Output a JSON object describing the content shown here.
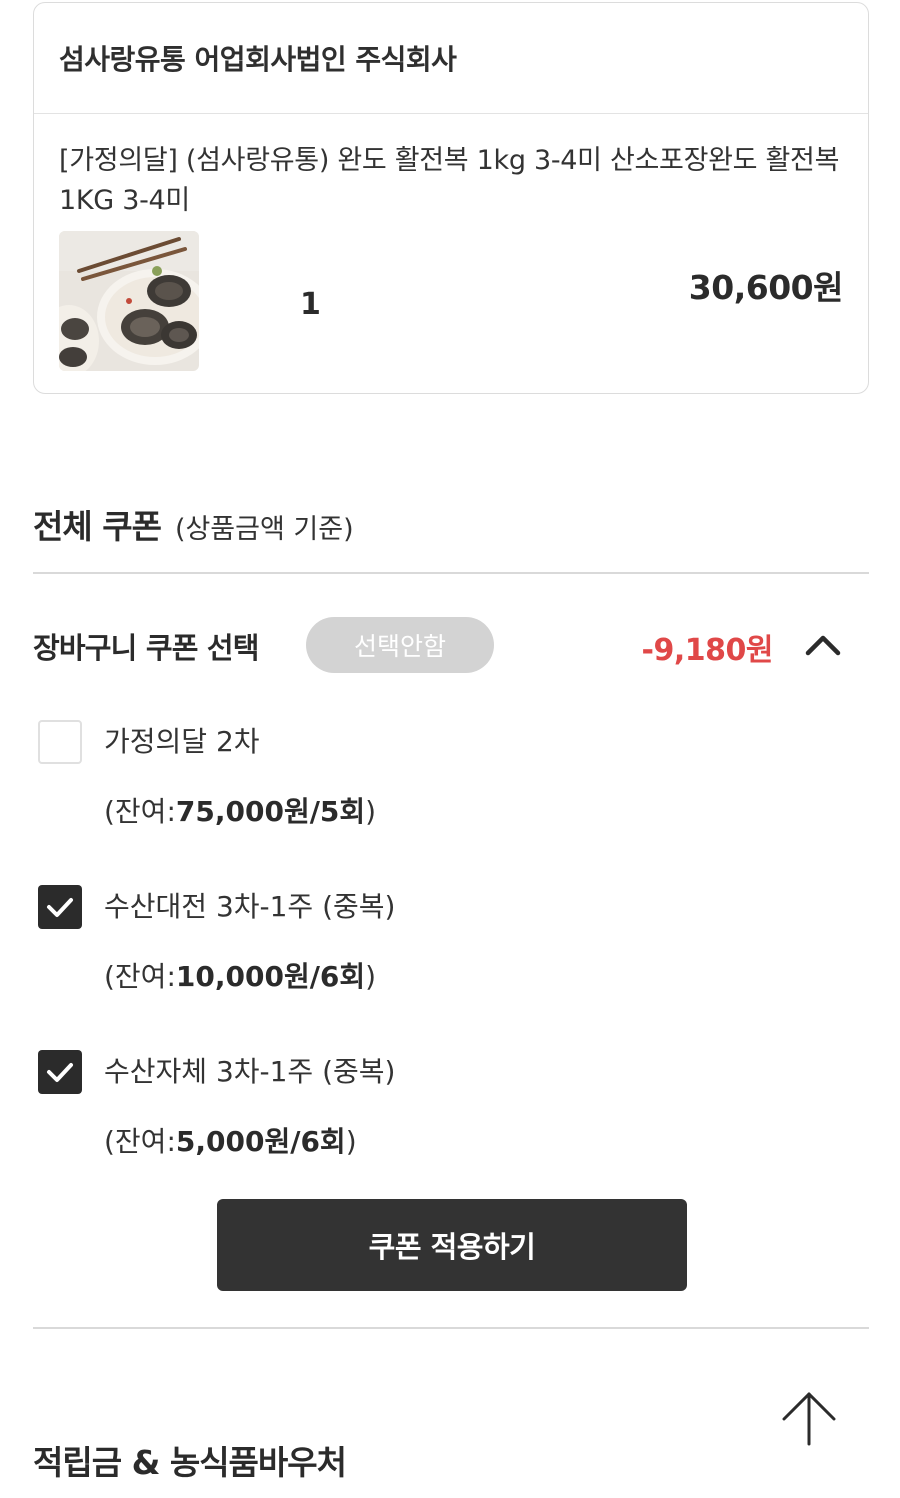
{
  "seller": {
    "name": "섬사랑유통 어업회사법인 주식회사"
  },
  "product": {
    "title": "[가정의달] (섬사랑유통) 완도 활전복 1kg 3-4미 산소포장완도 활전복 1KG 3-4미",
    "image_icon": "abalone-product-photo",
    "quantity": "1",
    "price": "30,600원"
  },
  "coupon_section": {
    "title": "전체 쿠폰",
    "subtitle": "(상품금액 기준)"
  },
  "cart_coupon": {
    "label": "장바구니 쿠폰 선택",
    "none_label": "선택안함",
    "discount": "-9,180원",
    "toggle_icon": "chevron-up-icon"
  },
  "coupons": [
    {
      "name": "가정의달 2차",
      "checked": false,
      "remain_prefix": "(잔여:",
      "remain_value": "75,000원/5회",
      "remain_suffix": ")"
    },
    {
      "name": "수산대전 3차-1주 (중복)",
      "checked": true,
      "remain_prefix": "(잔여:",
      "remain_value": "10,000원/6회",
      "remain_suffix": ")"
    },
    {
      "name": "수산자체 3차-1주 (중복)",
      "checked": true,
      "remain_prefix": "(잔여:",
      "remain_value": "5,000원/6회",
      "remain_suffix": ")"
    }
  ],
  "apply_button": {
    "label": "쿠폰 적용하기"
  },
  "scroll_top_icon": "arrow-up-icon",
  "points_section": {
    "title": "적립금 & 농식품바우처"
  },
  "colors": {
    "accent_red": "#e04848",
    "dark": "#333333",
    "pill_gray": "#d3d3d3"
  }
}
